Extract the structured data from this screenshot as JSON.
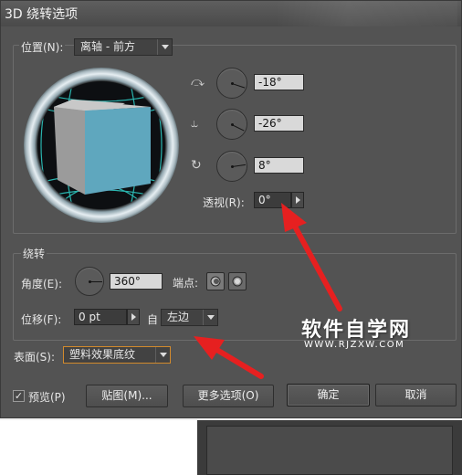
{
  "dialog": {
    "title": "3D 绕转选项",
    "position": {
      "label": "位置(N):",
      "value": "离轴 - 前方",
      "x_axis_value": "-18°",
      "y_axis_value": "-26°",
      "z_axis_value": "8°",
      "perspective_label": "透视(R):",
      "perspective_value": "0°"
    },
    "revolve": {
      "group_label": "绕转",
      "angle_label": "角度(E):",
      "angle_value": "360°",
      "cap_label": "端点:",
      "offset_label": "位移(F):",
      "offset_value": "0 pt",
      "from_label": "自",
      "from_value": "左边"
    },
    "surface": {
      "label": "表面(S):",
      "value": "塑料效果底纹"
    },
    "buttons": {
      "preview_checked": "✓",
      "preview_label": "预览(P)",
      "map_art": "贴图(M)...",
      "more_options": "更多选项(O)",
      "ok": "确定",
      "cancel": "取消"
    }
  },
  "watermark": {
    "text": "软件自学网",
    "url": "WWW.RJZXW.COM"
  },
  "colors": {
    "dialog_bg": "#535353",
    "cube_front": "#5fa7be",
    "cube_left": "#9a9a9a",
    "cube_top": "#c9c9c9",
    "sphere_grid": "#2ec7c0",
    "annotation_arrow": "#e62020",
    "surface_focus": "#d28a2c"
  }
}
